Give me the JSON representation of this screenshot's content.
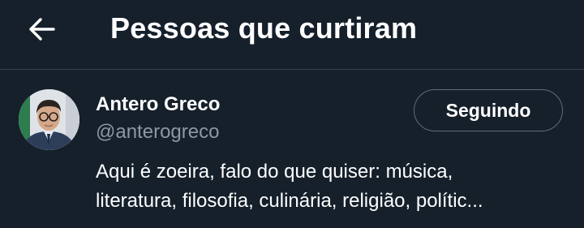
{
  "header": {
    "back_icon": "arrow-left-icon",
    "title": "Pessoas que curtiram"
  },
  "user": {
    "avatar_icon": "profile-photo",
    "name": "Antero Greco",
    "handle": "@anterogreco",
    "follow_button_label": "Seguindo",
    "bio_lines": [
      "Aqui é zoeira, falo do que quiser: música,",
      "literatura, filosofia, culinária, religião, polític..."
    ]
  },
  "colors": {
    "background": "#15202b",
    "text_primary": "#ffffff",
    "text_secondary": "#8b98a5",
    "divider": "#38444d",
    "button_border": "#5c6e7e"
  }
}
